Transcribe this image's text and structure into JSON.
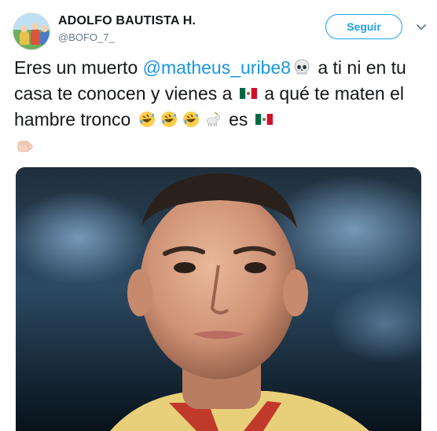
{
  "user": {
    "display_name": "ADOLFO BAUTISTA H.",
    "handle": "@BOFO_7_"
  },
  "follow_button": {
    "label": "Seguir"
  },
  "tweet": {
    "part1": "Eres un muerto ",
    "mention": "@matheus_uribe8",
    "part2": " a ti ni en tu casa te conocen y vienes a ",
    "part3": " a qué te maten el hambre tronco ",
    "part4": " es "
  },
  "icons": {
    "skull": "skull-emoji",
    "mexico_flag": "mexico-flag-emoji",
    "rofl": "rolling-on-floor-laughing-emoji",
    "goat": "goat-emoji",
    "fist": "oncoming-fist-emoji",
    "chevron": "chevron-down-icon"
  },
  "colors": {
    "accent": "#1da1f2",
    "mention": "#1b95e0",
    "muted": "#657786"
  }
}
